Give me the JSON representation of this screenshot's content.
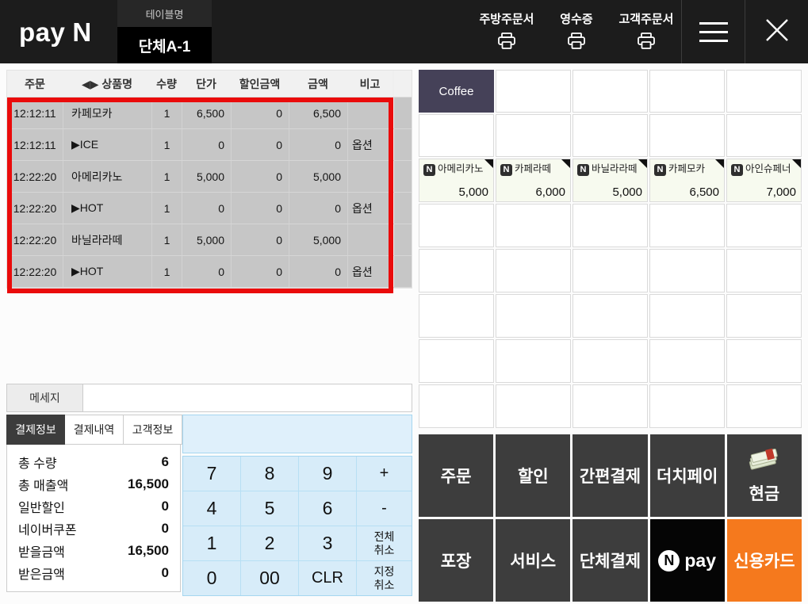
{
  "header": {
    "logo_pay": "pay",
    "logo_n": "N",
    "table_label": "테이블명",
    "table_name": "단체A-1",
    "print_kitchen": "주방주문서",
    "print_receipt": "영수증",
    "print_customer": "고객주문서"
  },
  "order_table": {
    "columns": [
      "주문",
      "◀▶ 상품명",
      "수량",
      "단가",
      "할인금액",
      "금액",
      "비고"
    ],
    "rows": [
      {
        "time": "12:12:11",
        "name": "카페모카",
        "qty": "1",
        "unit": "6,500",
        "discount": "0",
        "amount": "6,500",
        "note": ""
      },
      {
        "time": "12:12:11",
        "name": "▶ICE",
        "qty": "1",
        "unit": "0",
        "discount": "0",
        "amount": "0",
        "note": "옵션"
      },
      {
        "time": "12:22:20",
        "name": "아메리카노",
        "qty": "1",
        "unit": "5,000",
        "discount": "0",
        "amount": "5,000",
        "note": ""
      },
      {
        "time": "12:22:20",
        "name": "▶HOT",
        "qty": "1",
        "unit": "0",
        "discount": "0",
        "amount": "0",
        "note": "옵션"
      },
      {
        "time": "12:22:20",
        "name": "바닐라라떼",
        "qty": "1",
        "unit": "5,000",
        "discount": "0",
        "amount": "5,000",
        "note": ""
      },
      {
        "time": "12:22:20",
        "name": "▶HOT",
        "qty": "1",
        "unit": "0",
        "discount": "0",
        "amount": "0",
        "note": "옵션"
      }
    ]
  },
  "message": {
    "label": "메세지",
    "value": ""
  },
  "tabs": [
    {
      "label": "결제정보"
    },
    {
      "label": "결제내역"
    },
    {
      "label": "고객정보"
    }
  ],
  "summary": {
    "rows": [
      {
        "label": "총 수량",
        "value": "6"
      },
      {
        "label": "총 매출액",
        "value": "16,500"
      },
      {
        "label": "일반할인",
        "value": "0"
      },
      {
        "label": "네이버쿠폰",
        "value": "0"
      },
      {
        "label": "받을금액",
        "value": "16,500"
      },
      {
        "label": "받은금액",
        "value": "0"
      }
    ]
  },
  "keypad": {
    "display": "",
    "k7": "7",
    "k8": "8",
    "k9": "9",
    "plus": "+",
    "k4": "4",
    "k5": "5",
    "k6": "6",
    "minus": "-",
    "k1": "1",
    "k2": "2",
    "k3": "3",
    "cancel_all_1": "전체",
    "cancel_all_2": "취소",
    "k0": "0",
    "k00": "00",
    "clr": "CLR",
    "cancel_sel_1": "지정",
    "cancel_sel_2": "취소"
  },
  "menu": {
    "category_active": "Coffee",
    "badge": "N",
    "products": [
      {
        "name": "아메리카노",
        "price": "5,000"
      },
      {
        "name": "카페라떼",
        "price": "6,000"
      },
      {
        "name": "바닐라라떼",
        "price": "5,000"
      },
      {
        "name": "카페모카",
        "price": "6,500"
      },
      {
        "name": "아인슈페너",
        "price": "7,000"
      }
    ]
  },
  "actions": {
    "order": "주문",
    "discount": "할인",
    "easy_pay": "간편결제",
    "dutch_pay": "더치페이",
    "cash": "현금",
    "takeout": "포장",
    "service": "서비스",
    "group_pay": "단체결제",
    "npay_n": "N",
    "npay_pay": "pay",
    "credit_card": "신용카드"
  },
  "colors": {
    "highlight_red": "#ea0b0b",
    "credit_orange": "#f5791d",
    "coffee_category": "#454158",
    "keypad_blue": "#d7ecf9",
    "header_black": "#1c1c1c"
  }
}
